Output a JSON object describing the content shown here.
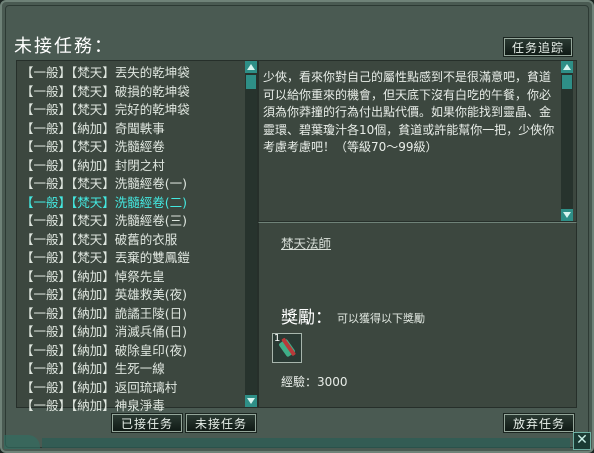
{
  "window": {
    "title": "未接任務："
  },
  "buttons": {
    "track": "任务追踪",
    "accepted": "已接任务",
    "unaccepted": "未接任务",
    "abandon": "放弃任务"
  },
  "quests": [
    "【一般】【梵天】丟失的乾坤袋",
    "【一般】【梵天】破損的乾坤袋",
    "【一般】【梵天】完好的乾坤袋",
    "【一般】【納加】奇聞軼事",
    "【一般】【梵天】洗髓經卷",
    "【一般】【納加】封閉之村",
    "【一般】【梵天】洗髓經卷(一)",
    "【一般】【梵天】洗髓經卷(二)",
    "【一般】【梵天】洗髓經卷(三)",
    "【一般】【梵天】破舊的衣服",
    "【一般】【梵天】丟棄的雙鳳鎧",
    "【一般】【納加】悼祭先皇",
    "【一般】【納加】英雄救美(夜)",
    "【一般】【納加】詭譎王陵(日)",
    "【一般】【納加】消滅兵俑(日)",
    "【一般】【納加】破除皇印(夜)",
    "【一般】【納加】生死一線",
    "【一般】【納加】返回琉璃村",
    "【一般】【納加】神泉淨毒"
  ],
  "selected_quest_index": 7,
  "description": "少俠，看來你對自己的屬性點感到不是很滿意吧，貧道可以給你重來的機會，但天底下沒有白吃的午餐，你必須為你莽撞的行為付出點代價。如果你能找到靈晶、金靈環、碧葉瓊汁各10個，貧道或許能幫你一把，少俠你考慮考慮吧！（等級70～99級）",
  "npc": "梵天法師",
  "reward": {
    "title": "獎勵：",
    "subtitle": "可以獲得以下獎勵",
    "item_count": "1",
    "item_icon": "scroll-icon",
    "exp": "經驗：3000"
  },
  "colors": {
    "selected": "#44e8e0",
    "text": "#dfe6df",
    "scroll": "#2e8f87"
  }
}
